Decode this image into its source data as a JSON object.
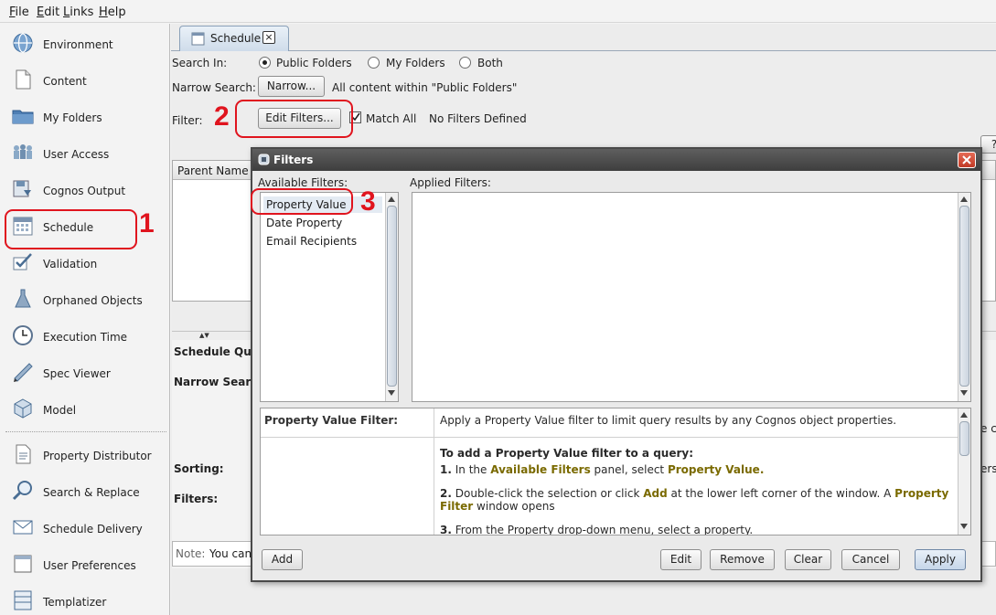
{
  "menu": [
    {
      "key": "F",
      "rest": "ile"
    },
    {
      "key": "E",
      "rest": "dit"
    },
    {
      "key": "L",
      "rest": "inks"
    },
    {
      "key": "H",
      "rest": "elp"
    }
  ],
  "sidebar": {
    "items": [
      {
        "label": "Environment",
        "icon": "globe-icon"
      },
      {
        "label": "Content",
        "icon": "document-icon"
      },
      {
        "label": "My Folders",
        "icon": "folder-icon"
      },
      {
        "label": "User Access",
        "icon": "users-icon"
      },
      {
        "label": "Cognos Output",
        "icon": "output-icon"
      },
      {
        "label": "Schedule",
        "icon": "calendar-icon"
      },
      {
        "label": "Validation",
        "icon": "checkmark-icon"
      },
      {
        "label": "Orphaned Objects",
        "icon": "flask-icon"
      },
      {
        "label": "Execution Time",
        "icon": "clock-icon"
      },
      {
        "label": "Spec Viewer",
        "icon": "pencil-icon"
      },
      {
        "label": "Model",
        "icon": "cube-icon"
      },
      {
        "label": "Property Distributor",
        "icon": "properties-icon"
      },
      {
        "label": "Search & Replace",
        "icon": "magnifier-icon"
      },
      {
        "label": "Schedule Delivery",
        "icon": "envelope-icon"
      },
      {
        "label": "User Preferences",
        "icon": "preferences-icon"
      },
      {
        "label": "Templatizer",
        "icon": "template-icon"
      }
    ]
  },
  "tab": {
    "label": "Schedule",
    "close": "×"
  },
  "search": {
    "search_in_label": "Search In:",
    "options": [
      "Public Folders",
      "My Folders",
      "Both"
    ],
    "selected": "Public Folders",
    "narrow_label": "Narrow Search:",
    "narrow_button": "Narrow...",
    "narrow_text": "All content within \"Public Folders\"",
    "filter_label": "Filter:",
    "edit_filters_button": "Edit Filters...",
    "match_all_label": "Match All",
    "match_all_checked": true,
    "filters_status": "No Filters Defined"
  },
  "results": {
    "column_parent": "Parent Name",
    "help_btn": "?"
  },
  "lower": {
    "schedule_query": "Schedule Que",
    "narrow_search": "Narrow Search",
    "sorting": "Sorting:",
    "filters": "Filters:",
    "note_label": "Note:",
    "note_text": "You can",
    "right_frag1": "e c",
    "right_frag2": "ers"
  },
  "annotations": [
    "1",
    "2",
    "3"
  ],
  "dialog": {
    "title": "Filters",
    "available_label": "Available Filters:",
    "applied_label": "Applied Filters:",
    "available": [
      "Property Value",
      "Date Property",
      "Email Recipients"
    ],
    "selected": "Property Value",
    "help": {
      "heading": "Property Value Filter:",
      "intro": "Apply a Property Value filter to limit query results by any Cognos object properties.",
      "howto": "To add a Property Value filter to a query:",
      "step1_num": "1.",
      "step1_a": "In the",
      "step1_b": "Available Filters",
      "step1_c": "panel, select",
      "step1_d": "Property Value.",
      "step2_num": "2.",
      "step2_a": "Double-click the selection or click",
      "step2_b": "Add",
      "step2_c": "at the lower left corner of the window. A",
      "step2_d": "Property",
      "step2_e": "Filter",
      "step2_f": "window opens",
      "step3_num": "3.",
      "step3_a": "From the Property drop-down menu, select a property."
    },
    "buttons": {
      "add": "Add",
      "edit": "Edit",
      "remove": "Remove",
      "clear": "Clear",
      "cancel": "Cancel",
      "apply": "Apply"
    }
  },
  "colors": {
    "accent_red": "#e0141e",
    "dialog_title": "#4a4a4a",
    "help_highlight": "#7a6a00"
  }
}
